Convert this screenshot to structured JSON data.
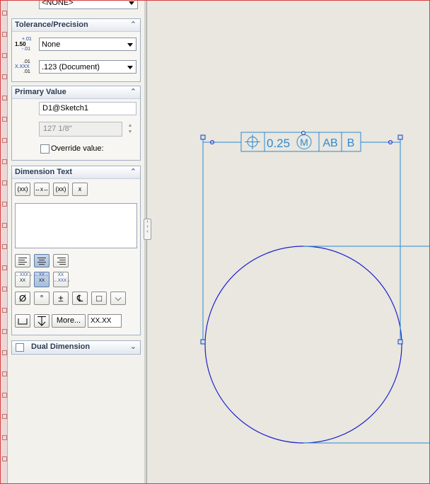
{
  "top_fragment": {
    "value": "<NONE>"
  },
  "tolerance": {
    "title": "Tolerance/Precision",
    "tol_icon": {
      "main": "1.50",
      "upper": "+.01",
      "lower": "-.01"
    },
    "prec_icon": {
      "main": "X.XXX",
      "upper": ".01",
      "lower": ".01"
    },
    "tolerance_type": "None",
    "precision": ".123 (Document)"
  },
  "primary": {
    "title": "Primary Value",
    "name": "D1@Sketch1",
    "value": "127 1/8\"",
    "override_label": "Override value:"
  },
  "dimtext": {
    "title": "Dimension Text",
    "top_buttons": [
      "(xx)",
      "↔x↔",
      "(xx)",
      "x"
    ],
    "text_area": "",
    "symbol_buttons": [
      "Ø",
      "°",
      "±",
      "℄",
      "□",
      "⌵"
    ],
    "more_label": "More...",
    "format_value": "XX.XX"
  },
  "dual": {
    "title": "Dual Dimension"
  },
  "drawing": {
    "fcf": {
      "tolerance": "0.25",
      "modifier": "M",
      "datum1": "AB",
      "datum2": "B"
    },
    "colors": {
      "geometry": "#1f1fd0",
      "annotation": "#2b8ad6",
      "background": "#e9e7df"
    }
  },
  "icons": [
    "collapse-chevron-icon",
    "dropdown-arrow-icon",
    "spin-arrow-icon",
    "position-symbol-icon"
  ]
}
